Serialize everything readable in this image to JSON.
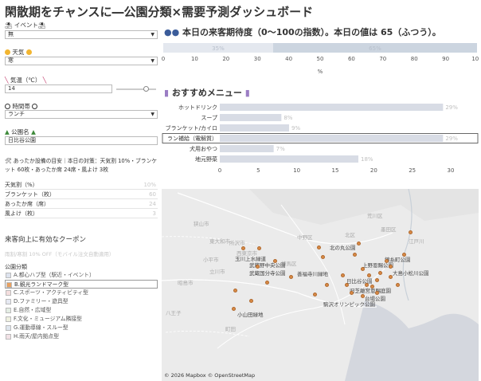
{
  "title": "閑散期をチャンスに―公園分類×需要予測ダッシュボード",
  "filters": {
    "event_label": "⛱ イベント⛱",
    "event_value": "無",
    "weather_label": "天気",
    "weather_value": "寒",
    "temp_label": "気温（℃）",
    "temp_value": "14",
    "temp_level": 0.75,
    "timeslot_label": "時間帯",
    "timeslot_value": "ランチ",
    "park_label": "公園名",
    "park_value": "日比谷公園"
  },
  "note": "🛠 あったか設備の目安｜本日の対策：天気割 10%・ブランケット 60枚・あったか席 24席・風よけ 3枚",
  "stats": [
    {
      "label": "天気割（%）",
      "value": "10%"
    },
    {
      "label": "ブランケット（枚）",
      "value": "60"
    },
    {
      "label": "あったか席（席）",
      "value": "24"
    },
    {
      "label": "風よけ（枚）",
      "value": "3"
    }
  ],
  "coupon": {
    "title": "来客向上に有効なクーポン",
    "subtitle": "雨割/寒割 10% OFF（モバイル注文自動適用）"
  },
  "categories": {
    "heading": "公園分類",
    "items": [
      {
        "label": "A.都心ハブ型（駅近・イベント）",
        "color": "#dde3ee"
      },
      {
        "label": "B.観光ランドマーク型",
        "color": "#e8a060"
      },
      {
        "label": "C.スポーツ・アクティビティ型",
        "color": "#f4dede"
      },
      {
        "label": "D.ファミリー・遊具型",
        "color": "#e6e9f2"
      },
      {
        "label": "E.自然・広域型",
        "color": "#e4ede4"
      },
      {
        "label": "F.文化・ミュージアム隣接型",
        "color": "#eef0e0"
      },
      {
        "label": "G.運動導線・スルー型",
        "color": "#dfe6ee"
      },
      {
        "label": "H.雨天/屋内拠点型",
        "color": "#f2e2e6"
      }
    ]
  },
  "expectation": {
    "heading": "本日の来客期待度（0〜100の指数）。本日の値は 65（ふつう）。",
    "xlabel": "%"
  },
  "menu": {
    "heading": "おすすめメニュー"
  },
  "map": {
    "credit": "© 2026 Mapbox  © OpenStreetMap",
    "places": [
      {
        "name": "荒川区",
        "faint": true
      },
      {
        "name": "北区",
        "faint": true
      },
      {
        "name": "狭山市",
        "faint": true
      },
      {
        "name": "所沢市",
        "faint": true
      },
      {
        "name": "練馬区",
        "faint": true
      },
      {
        "name": "西東京市",
        "faint": true
      },
      {
        "name": "東大和市",
        "faint": true
      },
      {
        "name": "小平市",
        "faint": true
      },
      {
        "name": "立川市",
        "faint": true
      },
      {
        "name": "昭島市",
        "faint": true
      },
      {
        "name": "玉川上水緑道",
        "faint": false
      },
      {
        "name": "武蔵野中央公園",
        "faint": false
      },
      {
        "name": "武蔵国分寺公園",
        "faint": false
      },
      {
        "name": "善福寺川緑地",
        "faint": false
      },
      {
        "name": "北の丸公園",
        "faint": false
      },
      {
        "name": "上野恩賜公園",
        "faint": false
      },
      {
        "name": "日比谷公園",
        "faint": false
      },
      {
        "name": "錦糸町公園",
        "faint": false
      },
      {
        "name": "旧芝離宮恩賜庭園",
        "faint": false
      },
      {
        "name": "駒沢オリンピック公園",
        "faint": false
      },
      {
        "name": "台場公園",
        "faint": false
      },
      {
        "name": "小山田緑地",
        "faint": false
      },
      {
        "name": "大島小松川公園",
        "faint": false
      },
      {
        "name": "八王子",
        "faint": true
      },
      {
        "name": "中野区",
        "faint": true
      },
      {
        "name": "町田",
        "faint": true
      },
      {
        "name": "墨田区",
        "faint": true
      },
      {
        "name": "江戸川",
        "faint": true
      }
    ]
  },
  "chart_data": [
    {
      "type": "bar",
      "orientation": "horizontal",
      "title": "本日の来客期待度（0〜100の指数）。本日の値は 65（ふつう）。",
      "xlabel": "%",
      "xlim": [
        0,
        100
      ],
      "xticks": [
        0,
        10,
        20,
        30,
        40,
        50,
        60,
        70,
        80,
        90,
        100
      ],
      "segments": [
        {
          "label": "35%",
          "value": 35,
          "color": "#e4e8ef"
        },
        {
          "label": "65%",
          "value": 65,
          "color": "#ccd5e0"
        }
      ]
    },
    {
      "type": "bar",
      "orientation": "horizontal",
      "title": "おすすめメニュー",
      "xlim": [
        0,
        33
      ],
      "xticks": [
        0,
        5,
        10,
        15,
        20,
        25,
        30
      ],
      "categories": [
        "ホットドリンク",
        "スープ",
        "ブランケット/カイロ",
        "ラン補給（電解質）",
        "犬用おやつ",
        "地元野菜"
      ],
      "values": [
        29,
        8,
        9,
        29,
        7,
        18
      ],
      "value_labels": [
        "29%",
        "8%",
        "9%",
        "29%",
        "7%",
        "18%"
      ],
      "bar_color": "#d8dce5",
      "highlight_index": 3
    }
  ]
}
